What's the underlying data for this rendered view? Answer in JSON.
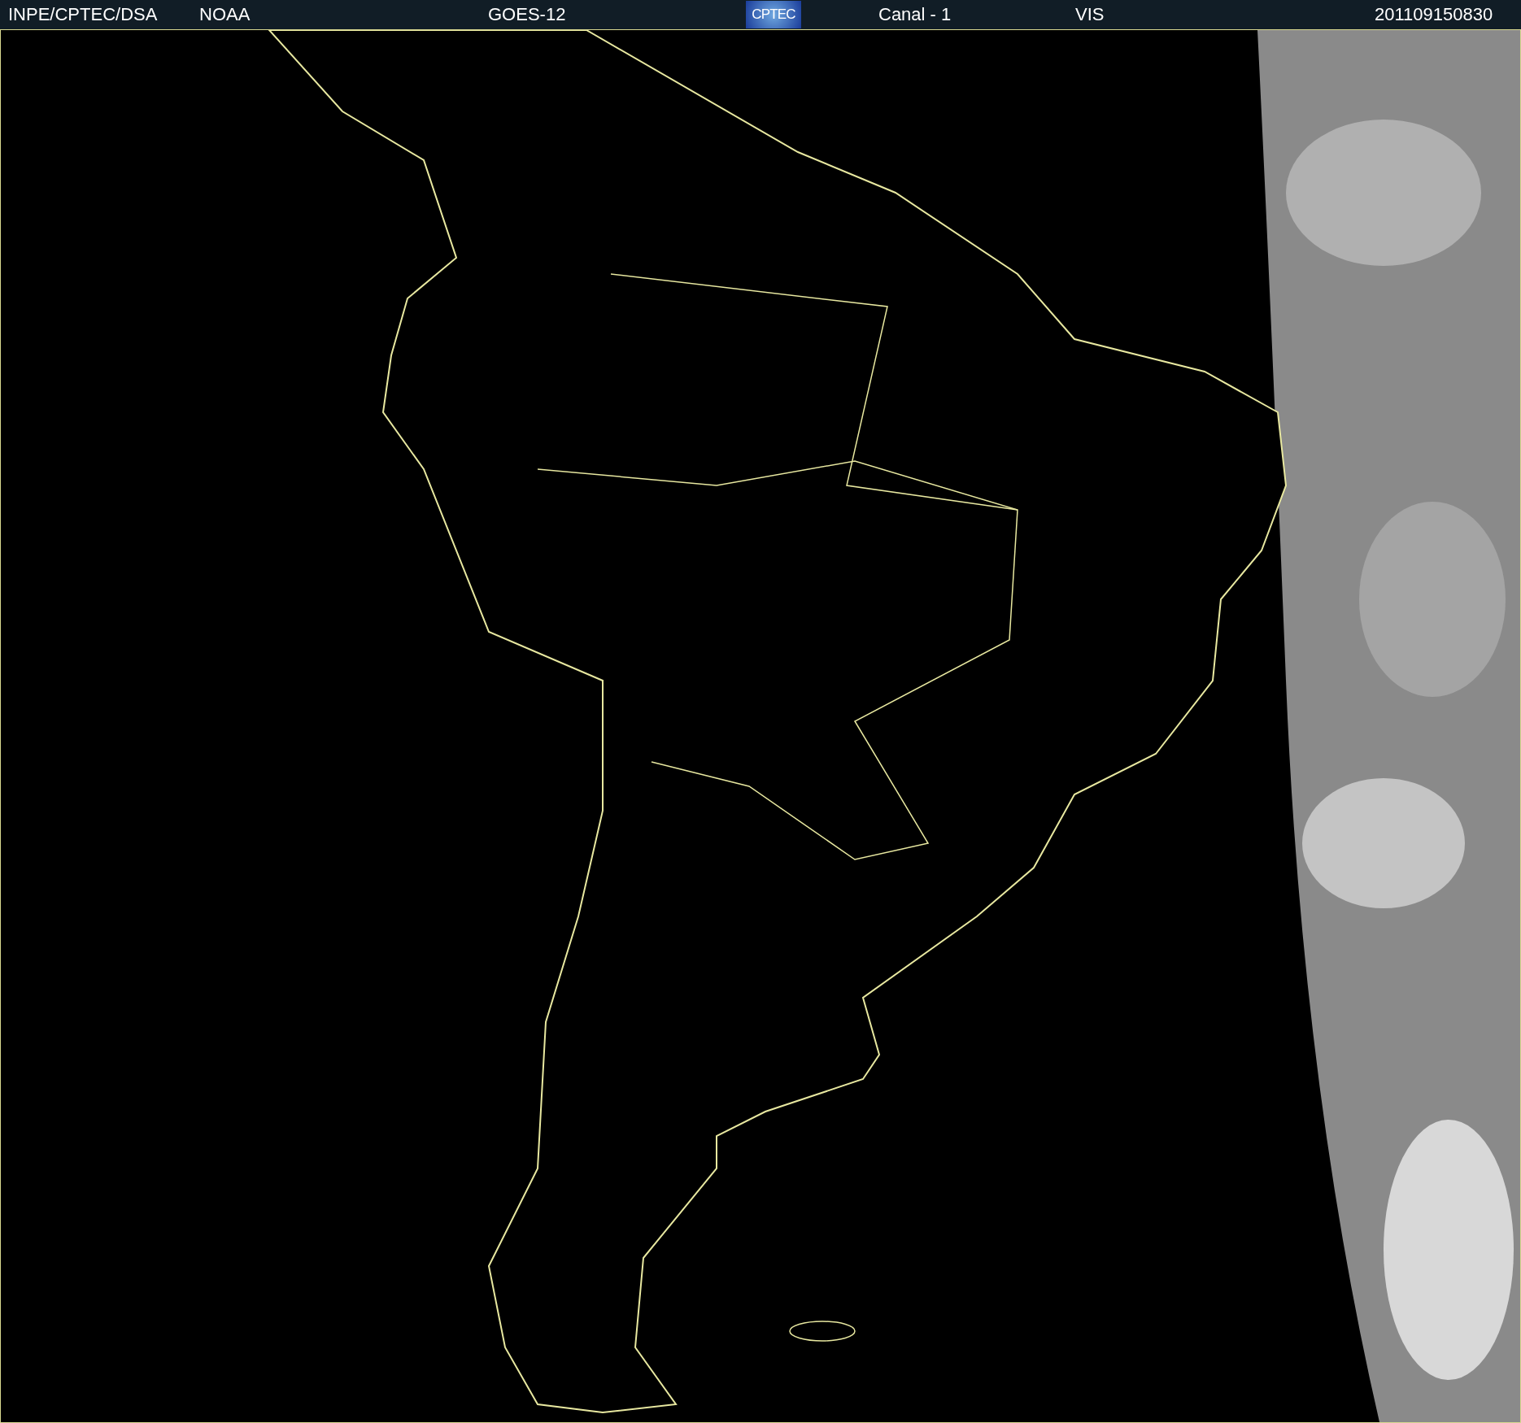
{
  "header": {
    "source": "INPE/CPTEC/DSA",
    "agency": "NOAA",
    "satellite": "GOES-12",
    "logo_text": "CPTEC",
    "channel": "Canal - 1",
    "band": "VIS",
    "timestamp": "201109150830"
  }
}
